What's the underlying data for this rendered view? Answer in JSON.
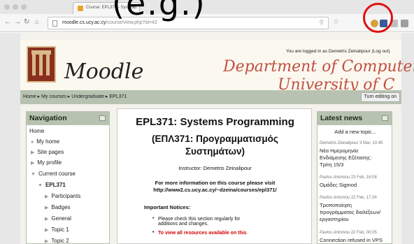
{
  "overlay_text": "(e.g.)",
  "browser": {
    "tab_title": "Course: EPL371 - Systems",
    "url_host": "moodle.cs.ucy.ac.cy",
    "url_path": "/course/view.php?id=42"
  },
  "header": {
    "site_name": "Moodle",
    "dept_line1": "Department of Computer S",
    "dept_line2": "University of C",
    "login_text": "You are logged in as Demetris Zeinalipour (Log out)"
  },
  "breadcrumb": {
    "text": "Home ▸ My courses ▸ Undergraduate ▸ EPL371",
    "turn_editing": "Turn editing on"
  },
  "navigation": {
    "title": "Navigation",
    "items": [
      {
        "label": "Home"
      },
      {
        "label": "My home"
      },
      {
        "label": "Site pages"
      },
      {
        "label": "My profile"
      },
      {
        "label": "Current course"
      },
      {
        "label": "EPL371"
      },
      {
        "label": "Participants"
      },
      {
        "label": "Badges"
      },
      {
        "label": "General"
      },
      {
        "label": "Topic 1"
      },
      {
        "label": "Topic 2"
      }
    ]
  },
  "course": {
    "title_en": "EPL371: Systems Programming",
    "title_gr_1": "(ΕΠΛ371: Προγραμματισμός",
    "title_gr_2": "Συστημάτων)",
    "instructor": "Instructor: Demetris Zeinalipour",
    "more_info_1": "For more information on this course please visit",
    "more_info_2": "http://www2.cs.ucy.ac.cy/~dzeina/courses/epl371/",
    "notices_title": "Important Notices:",
    "notice_1a": "Please check this section regularly for",
    "notice_1b": "additions and changes.",
    "notice_2": "To view all resources available on this"
  },
  "news": {
    "title": "Latest news",
    "add_topic": "Add a new topic...",
    "items": [
      {
        "author": "Demetris Zeinalipour",
        "date": "3 Mar, 10:45",
        "lines": [
          "Νέα Ημερομηνία",
          "Ενδιάμεσης Εξέτασης:",
          "Τρίτη 15/3"
        ]
      },
      {
        "author": "Pavlos Antoniou",
        "date": "23 Feb, 16:08",
        "lines": [
          "Ομάδες Sigmod"
        ]
      },
      {
        "author": "Pavlos Antoniou",
        "date": "22 Feb, 17:24",
        "lines": [
          "Τροποποίηση",
          "προγράμματος διαλέξεων/",
          "εργαστηρίου"
        ]
      },
      {
        "author": "Pavlos Antoniou",
        "date": "22 Feb, 00:05",
        "lines": [
          "Connection refused in VPS"
        ]
      }
    ]
  },
  "colors": {
    "block_header": "#b7c3b0",
    "dept_text": "#c0503f",
    "highlight_circle": "#e01010",
    "notice_red": "#d40000"
  }
}
